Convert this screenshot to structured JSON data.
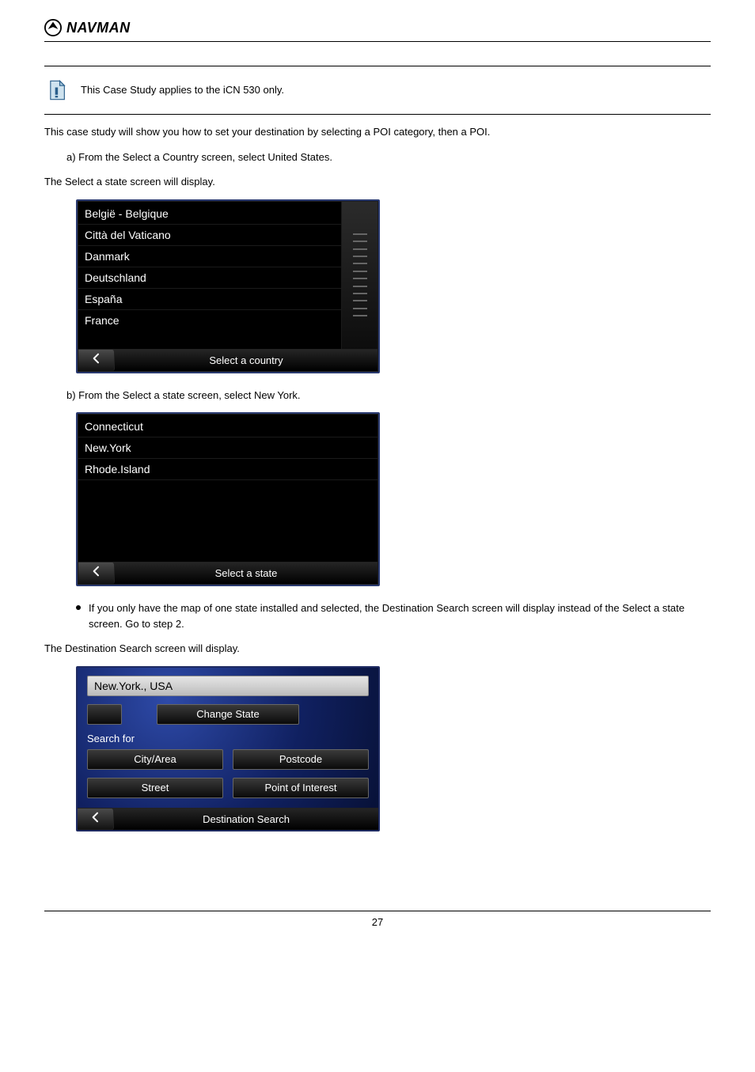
{
  "brand": {
    "name": "NAVMAN"
  },
  "note": {
    "text": "This Case Study applies to the iCN 530 only."
  },
  "paragraphs": {
    "p1": "This case study will show you how to set your destination by selecting a POI category, then a POI.",
    "p2_indent": "a) From the Select a Country screen, select United States.",
    "p3_lead": "The Select a state screen will display.",
    "p4_indent": "b) From the Select a state screen, select New York.",
    "p5_lead": "The Destination Search screen will display."
  },
  "screens": {
    "country": {
      "items": [
        "België - Belgique",
        "Città del Vaticano",
        "Danmark",
        "Deutschland",
        "España",
        "France"
      ],
      "footer": "Select a country"
    },
    "state": {
      "items": [
        "Connecticut",
        "New.York",
        "Rhode.Island"
      ],
      "footer": "Select a state"
    },
    "destination": {
      "location": "New.York., USA",
      "change_label": "Change State",
      "search_label": "Search for",
      "buttons": {
        "city": "City/Area",
        "postcode": "Postcode",
        "street": "Street",
        "poi": "Point of Interest"
      },
      "footer": "Destination Search"
    }
  },
  "bullets": {
    "b1": "If you only have the map of one state installed and selected, the Destination Search screen will display instead of the Select a state screen. Go to step 2."
  },
  "page_number": "27"
}
